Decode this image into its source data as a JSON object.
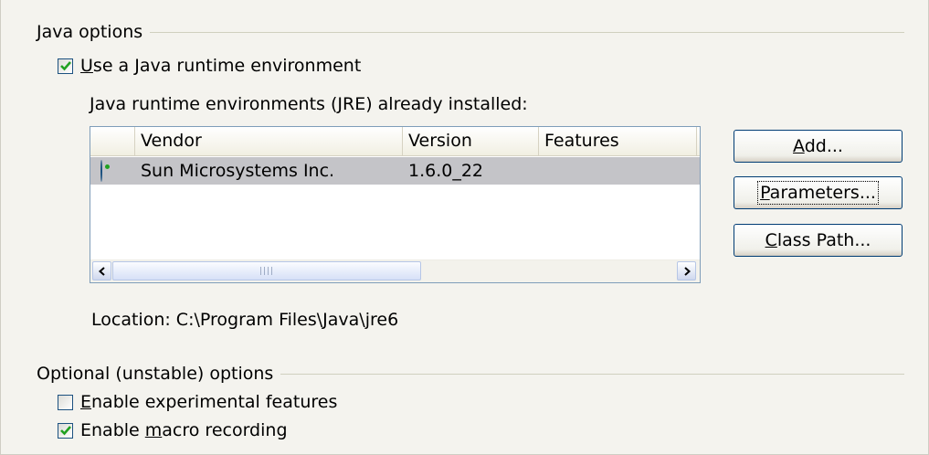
{
  "java_options": {
    "title": "Java options",
    "use_jre": {
      "label_pre": "",
      "label_ul": "U",
      "label_post": "se a Java runtime environment",
      "checked": true
    },
    "installed_label_ul": "J",
    "installed_label_post": "ava runtime environments (JRE) already installed:",
    "table": {
      "columns": [
        "",
        "Vendor",
        "Version",
        "Features"
      ],
      "rows": [
        {
          "selected": true,
          "vendor": "Sun Microsystems Inc.",
          "version": "1.6.0_22",
          "features": ""
        }
      ]
    },
    "location": "Location: C:\\Program Files\\Java\\jre6",
    "buttons": {
      "add_ul": "A",
      "add_post": "dd...",
      "parameters_ul": "P",
      "parameters_post": "arameters...",
      "classpath_ul": "C",
      "classpath_post": "lass Path..."
    }
  },
  "optional_options": {
    "title": "Optional (unstable) options",
    "experimental": {
      "label_ul": "E",
      "label_post": "nable experimental features",
      "checked": false
    },
    "macro": {
      "label_pre": "Enable ",
      "label_ul": "m",
      "label_post": "acro recording",
      "checked": true
    }
  },
  "colors": {
    "accent_check": "#21a121",
    "border": "#1c5180"
  }
}
